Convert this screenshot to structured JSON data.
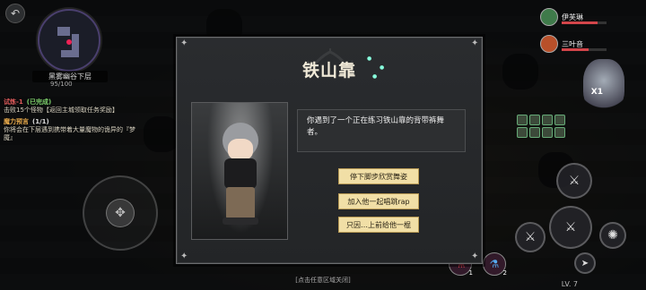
{
  "hud": {
    "map_name": "黑雾幽谷下层",
    "map_progress": "95/100",
    "level": "LV. 7",
    "multiplier": "X1"
  },
  "quests": [
    {
      "title": "试炼-1",
      "status": "(已完成)",
      "desc": "击败15个怪物【返回主城领取任务奖励】"
    },
    {
      "title": "魔力预言",
      "status": "(1/1)",
      "desc": "你将会在下层遇到携带着大量魔物的诡异的『梦魇』"
    }
  ],
  "party": [
    {
      "name": "伊芙琳",
      "hp": 0.8,
      "color": "#3f7a4a"
    },
    {
      "name": "三叶音",
      "hp": 0.6,
      "color": "#b8502a"
    }
  ],
  "potions": [
    {
      "count": "1",
      "icon": "red-potion-icon"
    },
    {
      "count": "2",
      "icon": "blue-potion-icon"
    }
  ],
  "dialog": {
    "title": "铁山靠",
    "description": "你遇到了一个正在练习铁山靠的背带裤舞者。",
    "options": [
      "停下脚步欣赏舞姿",
      "加入他一起唱跳rap",
      "只因…上前给他一棍"
    ]
  },
  "bottom_hint": "[点击任意区域关闭]"
}
